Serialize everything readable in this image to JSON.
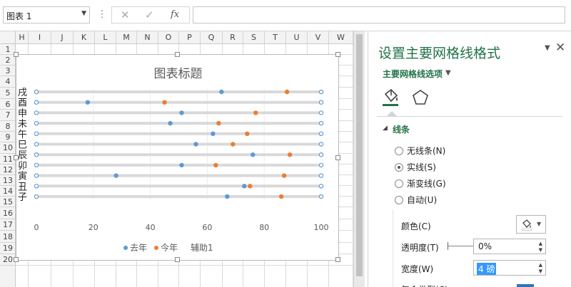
{
  "formula_bar": {
    "name_box": "图表 1",
    "cancel_icon": "✕",
    "enter_icon": "✓",
    "fx_icon": "fx",
    "formula": ""
  },
  "columns": [
    "H",
    "I",
    "J",
    "K",
    "L",
    "M",
    "N",
    "O",
    "P",
    "Q",
    "R",
    "S",
    "T",
    "U",
    "V",
    "W"
  ],
  "rows": [
    "1",
    "2",
    "3",
    "4",
    "5",
    "6",
    "7",
    "8",
    "9",
    "10",
    "11",
    "12",
    "13",
    "14",
    "15",
    "16",
    "17",
    "18",
    "19",
    "20"
  ],
  "chart": {
    "title": "图表标题",
    "legend": [
      "去年",
      "今年",
      "辅助1"
    ]
  },
  "chart_data": {
    "type": "scatter",
    "title": "图表标题",
    "categories": [
      "戌",
      "酉",
      "申",
      "未",
      "午",
      "巳",
      "辰",
      "卯",
      "寅",
      "丑",
      "子"
    ],
    "xlim": [
      0,
      100
    ],
    "x_ticks": [
      "0",
      "20",
      "40",
      "60",
      "80",
      "100"
    ],
    "grid": false,
    "legend_position": "bottom",
    "series": [
      {
        "name": "去年",
        "color": "#5b9bd5",
        "values": [
          65,
          18,
          51,
          47,
          62,
          56,
          76,
          51,
          28,
          73,
          67
        ]
      },
      {
        "name": "今年",
        "color": "#ed7d31",
        "values": [
          88,
          45,
          77,
          64,
          74,
          69,
          89,
          63,
          87,
          75,
          86
        ]
      },
      {
        "name": "辅助1",
        "color": "#5b9bd5",
        "values": [
          0,
          0,
          0,
          0,
          0,
          0,
          0,
          0,
          0,
          0,
          0
        ]
      }
    ],
    "helper_end_values": [
      100,
      100,
      100,
      100,
      100,
      100,
      100,
      100,
      100,
      100,
      100
    ]
  },
  "pane": {
    "title": "设置主要网格线格式",
    "close_icon": "✕",
    "subtitle": "主要网格线选项",
    "section": "线条",
    "radios": [
      {
        "label": "无线条(N)",
        "selected": false
      },
      {
        "label": "实线(S)",
        "selected": true
      },
      {
        "label": "渐变线(G)",
        "selected": false
      },
      {
        "label": "自动(U)",
        "selected": false
      }
    ],
    "color_label": "颜色(C)",
    "transparency_label": "透明度(T)",
    "transparency_value": "0%",
    "width_label": "宽度(W)",
    "width_value": "4 磅",
    "next_label": "复合类型(C)"
  },
  "colors": {
    "accent": "#217346",
    "series_blue": "#5b9bd5",
    "series_orange": "#ed7d31",
    "width_swatch": "#2e75b6"
  }
}
